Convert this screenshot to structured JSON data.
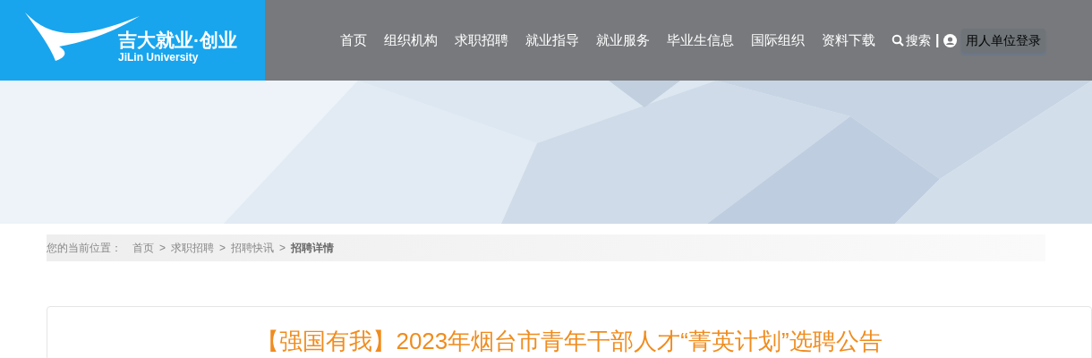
{
  "logo": {
    "title": "吉大就业·创业",
    "subtitle": "JiLin University"
  },
  "nav": [
    {
      "label": "首页"
    },
    {
      "label": "组织机构"
    },
    {
      "label": "求职招聘"
    },
    {
      "label": "就业指导"
    },
    {
      "label": "就业服务"
    },
    {
      "label": "毕业生信息"
    },
    {
      "label": "国际组织"
    },
    {
      "label": "资料下载"
    }
  ],
  "search": {
    "label": "搜索"
  },
  "divider": "|",
  "login": {
    "label": "用人单位登录"
  },
  "breadcrumb": {
    "label": "您的当前位置：",
    "separator": ">",
    "items": [
      {
        "label": "首页",
        "selected": false
      },
      {
        "label": "求职招聘",
        "selected": false
      },
      {
        "label": "招聘快讯",
        "selected": false
      },
      {
        "label": "招聘详情",
        "selected": true
      }
    ]
  },
  "article": {
    "title": "【强国有我】2023年烟台市青年干部人才“菁英计划”选聘公告"
  }
}
